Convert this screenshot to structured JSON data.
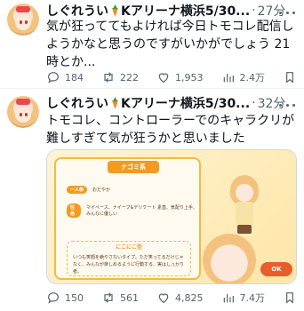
{
  "tweets": [
    {
      "name": "しぐれうい",
      "venue": "Kアリーナ横浜5/30...",
      "dot": "·",
      "time": "27分",
      "text": "気が狂っててもよければ今日トモコレ配信しようかなと思うのですがいかがでしょう 21時とか...",
      "replies": "184",
      "retweets": "222",
      "likes": "1,953",
      "views": "2.4万"
    },
    {
      "name": "しぐれうい",
      "venue": "Kアリーナ横浜5/30...",
      "dot": "·",
      "time": "32分",
      "text": "トモコレ、コントローラーでのキャラクリが難しすぎて気が狂うかと思いました",
      "replies": "150",
      "retweets": "561",
      "likes": "4,825",
      "views": "7.4万",
      "image": {
        "ribbon": "ナゴミ系",
        "rows": [
          {
            "tag": "一人称",
            "value": "おだやか"
          },
          {
            "tag": "性格",
            "value": "マイペース、ナイーブ&デリケート 素直、気配り上手、みんなに優しい"
          }
        ],
        "box_title": "にこにこ型",
        "box_text": "いつも笑顔を絶やさないタイプ。ただ笑ってるだけじゃなく、みんなが楽しめるように行動する、実はしっかり者。",
        "ok_label": "OK"
      }
    }
  ],
  "colors": {
    "muted": "#536471",
    "text": "#0f1419",
    "carrot": "#f08a24",
    "divider": "#eff3f4"
  }
}
